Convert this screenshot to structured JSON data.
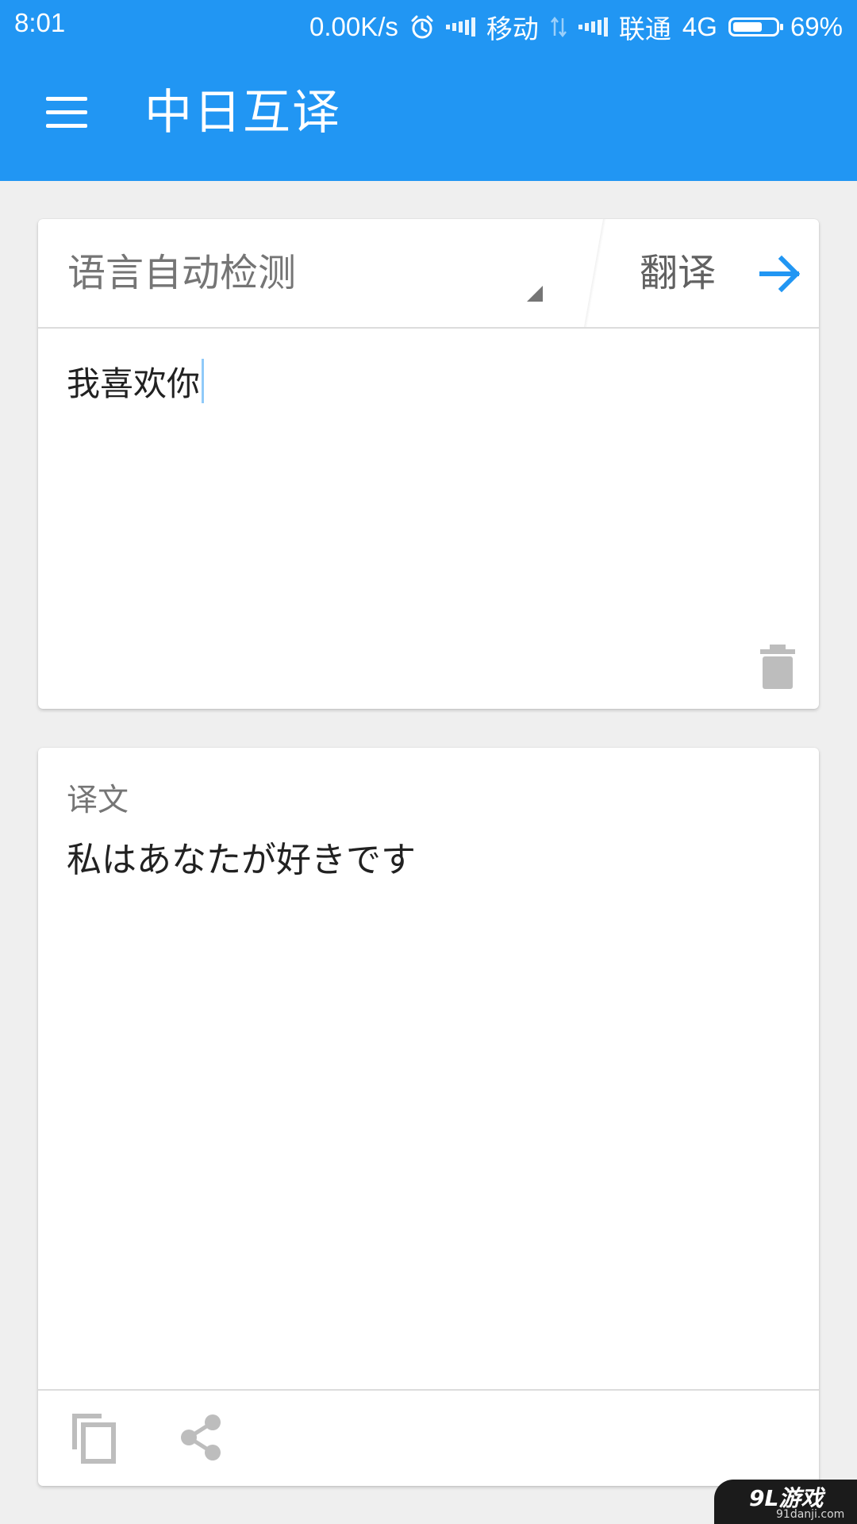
{
  "status_bar": {
    "time": "8:01",
    "network_speed": "0.00K/s",
    "carrier_1": "移动",
    "carrier_2": "联通",
    "network_type": "4G",
    "battery_percent": "69%",
    "battery_level": 0.69,
    "icons": [
      "alarm-icon",
      "signal-icon",
      "data-transfer-icon",
      "signal-icon",
      "battery-icon"
    ]
  },
  "app_bar": {
    "title": "中日互译",
    "menu_icon": "menu-icon"
  },
  "input_card": {
    "language_select": "语言自动检测",
    "translate_label": "翻译",
    "translate_icon": "arrow-right-icon",
    "input_text": "我喜欢你",
    "clear_icon": "trash-icon"
  },
  "output_card": {
    "label": "译文",
    "result_text": "私はあなたが好きです",
    "copy_icon": "copy-icon",
    "share_icon": "share-icon"
  },
  "watermark": {
    "brand": "9L游戏",
    "site": "91danji.com"
  },
  "colors": {
    "primary": "#2196f3",
    "background": "#efefef",
    "card": "#ffffff",
    "icon_gray": "#bdbdbd",
    "text_primary": "#212121",
    "text_secondary": "#757575"
  }
}
